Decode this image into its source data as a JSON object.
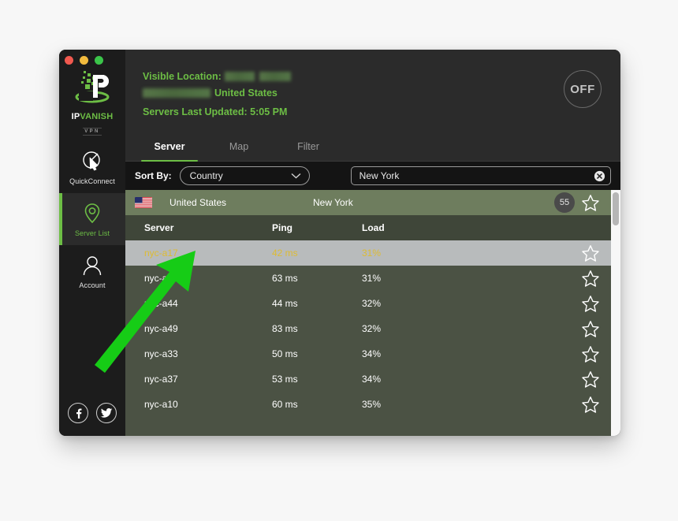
{
  "window": {
    "traffic_lights": [
      "close",
      "minimize",
      "maximize"
    ],
    "colors": {
      "accent_green": "#6dbe45",
      "row_green": "#4b5244",
      "country_bar": "#6e7d5e",
      "selected_row": "#b8bbbc",
      "selected_text": "#ddbb33"
    }
  },
  "sidebar": {
    "logo": {
      "ip": "IP",
      "vanish": "VANISH",
      "vpn": "VPN"
    },
    "items": [
      {
        "label": "QuickConnect",
        "icon": "quickconnect-icon",
        "active": false
      },
      {
        "label": "Server List",
        "icon": "location-pin-icon",
        "active": true
      },
      {
        "label": "Account",
        "icon": "user-icon",
        "active": false
      }
    ],
    "social": [
      {
        "name": "facebook-icon",
        "glyph": "f"
      },
      {
        "name": "twitter-icon",
        "glyph": "t"
      }
    ]
  },
  "topbar": {
    "visible_location_label": "Visible Location:",
    "visible_location_country": "United States",
    "visible_location_redacted": true,
    "servers_last_updated": "Servers Last Updated: 5:05 PM",
    "power_button": "OFF"
  },
  "tabs": [
    {
      "label": "Server",
      "active": true
    },
    {
      "label": "Map",
      "active": false
    },
    {
      "label": "Filter",
      "active": false
    }
  ],
  "filterbar": {
    "sort_by_label": "Sort By:",
    "sort_by_value": "Country",
    "sort_by_options": [
      "Country"
    ],
    "search_value": "New York",
    "search_placeholder": "Search",
    "clear_icon": "clear-circle-icon"
  },
  "country_row": {
    "flag": "us-flag-icon",
    "country": "United States",
    "region": "New York",
    "count": "55",
    "favorite_icon": "star-outline-icon"
  },
  "table": {
    "columns": [
      "Server",
      "Ping",
      "Load"
    ],
    "rows": [
      {
        "server": "nyc-a17",
        "ping": "42 ms",
        "load": "31%",
        "selected": true
      },
      {
        "server": "nyc-a41",
        "ping": "63 ms",
        "load": "31%",
        "selected": false
      },
      {
        "server": "nyc-a44",
        "ping": "44 ms",
        "load": "32%",
        "selected": false
      },
      {
        "server": "nyc-a49",
        "ping": "83 ms",
        "load": "32%",
        "selected": false
      },
      {
        "server": "nyc-a33",
        "ping": "50 ms",
        "load": "34%",
        "selected": false
      },
      {
        "server": "nyc-a37",
        "ping": "53 ms",
        "load": "34%",
        "selected": false
      },
      {
        "server": "nyc-a10",
        "ping": "60 ms",
        "load": "35%",
        "selected": false
      }
    ]
  },
  "annotation": {
    "arrow_color": "#16cc16",
    "points_to": "nyc-a17"
  }
}
